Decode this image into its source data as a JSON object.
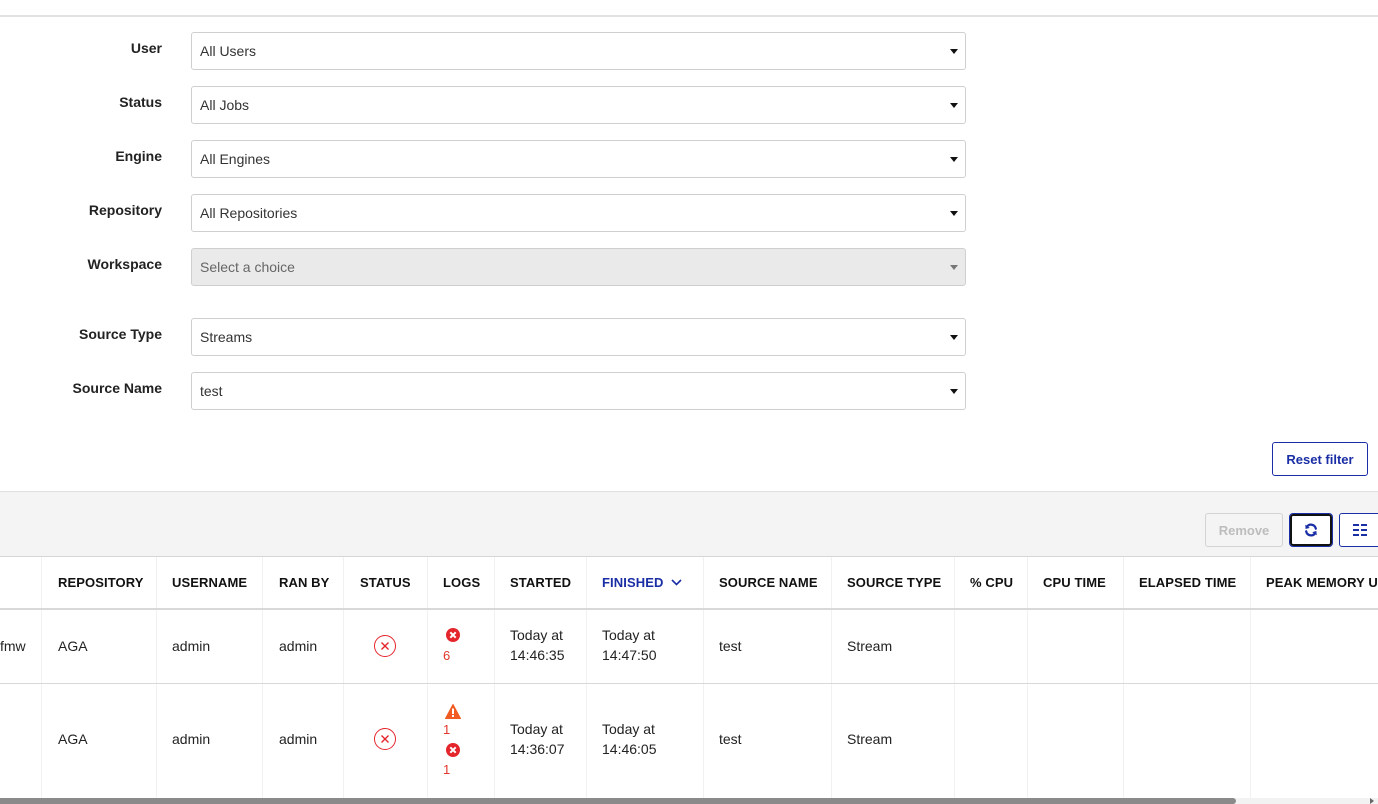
{
  "filters": [
    {
      "label": "User",
      "value": "All Users",
      "disabled": false
    },
    {
      "label": "Status",
      "value": "All Jobs",
      "disabled": false
    },
    {
      "label": "Engine",
      "value": "All Engines",
      "disabled": false
    },
    {
      "label": "Repository",
      "value": "All Repositories",
      "disabled": false
    },
    {
      "label": "Workspace",
      "placeholder": "Select a choice",
      "disabled": true
    },
    {
      "label": "Source Type",
      "value": "Streams",
      "disabled": false
    },
    {
      "label": "Source Name",
      "value": "test",
      "disabled": false
    }
  ],
  "reset_filter_label": "Reset filter",
  "toolbar": {
    "remove_label": "Remove",
    "refresh_icon": "refresh-icon",
    "columns_icon": "columns-icon"
  },
  "colors": {
    "accent": "#1a2ea5",
    "error": "#e5252c",
    "warning": "#f15a22"
  },
  "table": {
    "columns": [
      "REPOSITORY",
      "USERNAME",
      "RAN BY",
      "STATUS",
      "LOGS",
      "STARTED",
      "FINISHED",
      "SOURCE NAME",
      "SOURCE TYPE",
      "% CPU",
      "CPU TIME",
      "ELAPSED TIME",
      "PEAK MEMORY U"
    ],
    "sorted_column": "FINISHED",
    "sort_direction": "descending",
    "rows": [
      {
        "truncated_prefix": "fmw",
        "repository": "AGA",
        "username": "admin",
        "ran_by": "admin",
        "status": "failed",
        "logs": {
          "warnings": null,
          "errors": "6"
        },
        "started_line1": "Today at",
        "started_line2": "14:46:35",
        "finished_line1": "Today at",
        "finished_line2": "14:47:50",
        "source_name": "test",
        "source_type": "Stream",
        "cpu_pct": "",
        "cpu_time": "",
        "elapsed_time": "",
        "peak_memory": ""
      },
      {
        "truncated_prefix": "",
        "repository": "AGA",
        "username": "admin",
        "ran_by": "admin",
        "status": "failed",
        "logs": {
          "warnings": "1",
          "errors": "1"
        },
        "started_line1": "Today at",
        "started_line2": "14:36:07",
        "finished_line1": "Today at",
        "finished_line2": "14:46:05",
        "source_name": "test",
        "source_type": "Stream",
        "cpu_pct": "",
        "cpu_time": "",
        "elapsed_time": "",
        "peak_memory": ""
      }
    ]
  }
}
